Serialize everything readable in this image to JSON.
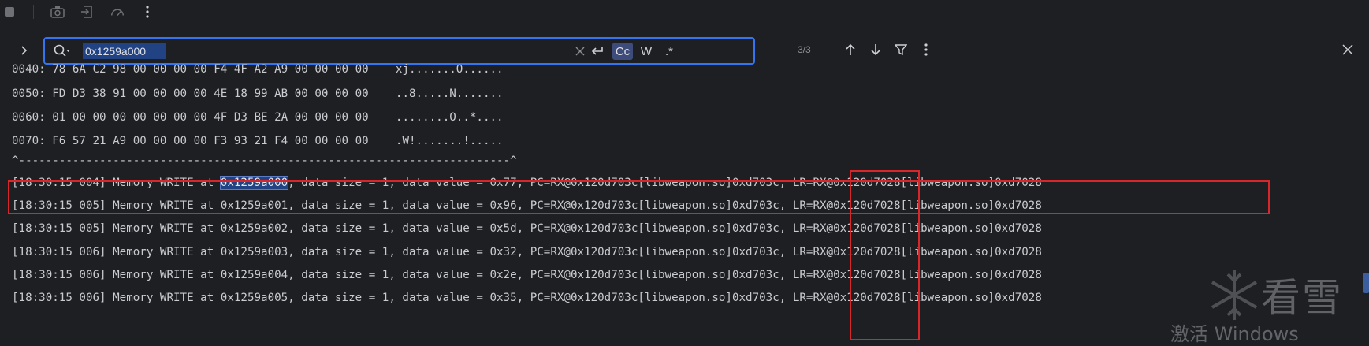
{
  "toolbar": {
    "icons": [
      "stop-icon",
      "camera-icon",
      "import-icon",
      "speedometer-icon",
      "more-vertical-icon"
    ]
  },
  "search": {
    "value": "0x1259a000",
    "match_count": "3/3",
    "case_label": "Cc",
    "word_label": "W",
    "regex_label": ".*"
  },
  "hex_dump": [
    {
      "offset": "0040:",
      "bytes": "78 6A C2 98 00 00 00 00 F4 4F A2 A9 00 00 00 00",
      "ascii": "xj.......O......"
    },
    {
      "offset": "0050:",
      "bytes": "FD D3 38 91 00 00 00 00 4E 18 99 AB 00 00 00 00",
      "ascii": "..8.....N......."
    },
    {
      "offset": "0060:",
      "bytes": "01 00 00 00 00 00 00 00 4F D3 BE 2A 00 00 00 00",
      "ascii": "........O..*...."
    },
    {
      "offset": "0070:",
      "bytes": "F6 57 21 A9 00 00 00 00 F3 93 21 F4 00 00 00 00",
      "ascii": ".W!.......!....."
    }
  ],
  "separator": "^-------------------------------------------------------------------------^",
  "log_lines": [
    {
      "prefix": "[18:30:15 004] Memory WRITE at ",
      "addr": "0x1259a000",
      "suffix": ", data size = 1, data value = 0x77, PC=RX@0x120d703c[libweapon.so]0xd703c, LR=RX@0x120d7028[libweapon.so]0xd7028"
    },
    {
      "prefix": "[18:30:15 005] Memory WRITE at ",
      "addr": "0x1259a001",
      "suffix": ", data size = 1, data value = 0x96, PC=RX@0x120d703c[libweapon.so]0xd703c, LR=RX@0x120d7028[libweapon.so]0xd7028"
    },
    {
      "prefix": "[18:30:15 005] Memory WRITE at ",
      "addr": "0x1259a002",
      "suffix": ", data size = 1, data value = 0x5d, PC=RX@0x120d703c[libweapon.so]0xd703c, LR=RX@0x120d7028[libweapon.so]0xd7028"
    },
    {
      "prefix": "[18:30:15 006] Memory WRITE at ",
      "addr": "0x1259a003",
      "suffix": ", data size = 1, data value = 0x32, PC=RX@0x120d703c[libweapon.so]0xd703c, LR=RX@0x120d7028[libweapon.so]0xd7028"
    },
    {
      "prefix": "[18:30:15 006] Memory WRITE at ",
      "addr": "0x1259a004",
      "suffix": ", data size = 1, data value = 0x2e, PC=RX@0x120d703c[libweapon.so]0xd703c, LR=RX@0x120d7028[libweapon.so]0xd7028"
    },
    {
      "prefix": "[18:30:15 006] Memory WRITE at ",
      "addr": "0x1259a005",
      "suffix": ", data size = 1, data value = 0x35, PC=RX@0x120d703c[libweapon.so]0xd703c, LR=RX@0x120d7028[libweapon.so]0xd7028"
    }
  ],
  "watermark": {
    "title": "看雪",
    "activate": "激活 Windows"
  },
  "colors": {
    "background": "#1e1f22",
    "search_border": "#3574f0",
    "match_highlight": "#214283",
    "annotation_red": "#d9262a"
  }
}
